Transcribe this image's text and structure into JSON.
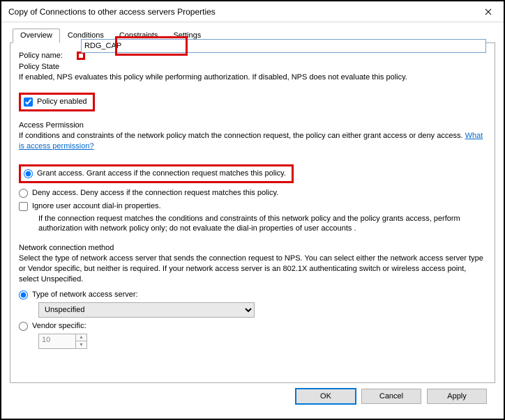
{
  "window": {
    "title": "Copy of Connections to other access servers Properties"
  },
  "tabs": {
    "overview": "Overview",
    "conditions": "Conditions",
    "constraints": "Constraints",
    "settings": "Settings"
  },
  "overview": {
    "policy_name_label": "Policy name:",
    "policy_name_value": "RDG_CAP",
    "policy_state": {
      "title": "Policy State",
      "desc": "If enabled, NPS evaluates this policy while performing authorization. If disabled, NPS does not evaluate this policy.",
      "enabled_label": "Policy enabled"
    },
    "access_permission": {
      "title": "Access Permission",
      "desc_pre": "If conditions and constraints of the network policy match the connection request, the policy can either grant access or deny access. ",
      "link": "What is access permission?",
      "grant_label": "Grant access. Grant access if the connection request matches this policy.",
      "deny_label": "Deny access. Deny access if the connection request matches this policy.",
      "ignore_label": "Ignore user account dial-in properties.",
      "ignore_desc": "If the connection request matches the conditions and constraints of this network policy and the policy grants access, perform authorization with network policy only; do not evaluate the dial-in properties of user accounts ."
    },
    "network_method": {
      "title": "Network connection method",
      "desc": "Select the type of network access server that sends the connection request to NPS. You can select either the network access server type or Vendor specific, but neither is required.  If your network access server is an 802.1X authenticating switch or wireless access point, select Unspecified.",
      "type_label": "Type of network access server:",
      "type_value": "Unspecified",
      "vendor_label": "Vendor specific:",
      "vendor_value": "10"
    }
  },
  "buttons": {
    "ok": "OK",
    "cancel": "Cancel",
    "apply": "Apply"
  }
}
